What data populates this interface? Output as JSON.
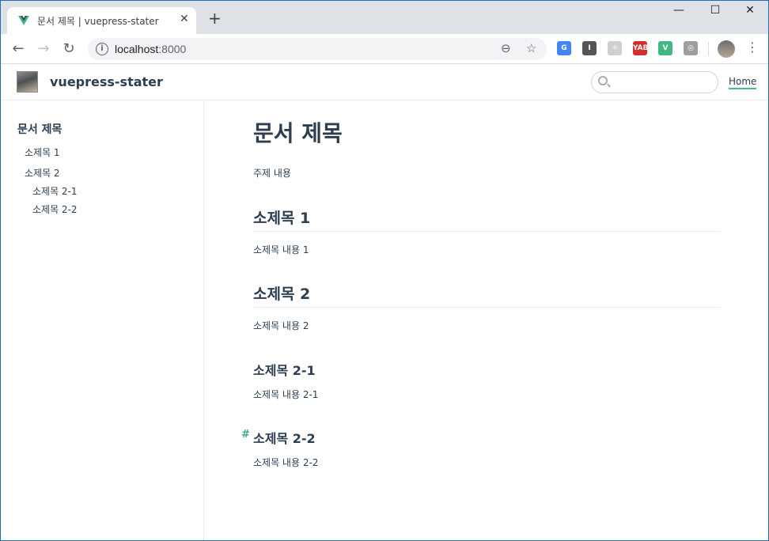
{
  "browser": {
    "tab_title": "문서 제목 | vuepress-stater",
    "tab_close": "✕",
    "new_tab": "+",
    "window_controls": {
      "minimize": "—",
      "maximize": "☐",
      "close": "✕"
    },
    "nav": {
      "back": "←",
      "forward": "→",
      "reload": "↻"
    },
    "address": {
      "host": "localhost",
      "port": ":8000"
    },
    "omnibox_icons": [
      "zoom-out-icon",
      "bookmark-star-icon"
    ],
    "extensions": [
      {
        "name": "google-translate-extension-icon",
        "label": "G",
        "color": "#4285f4"
      },
      {
        "name": "instapaper-extension-icon",
        "label": "I",
        "color": "#555555"
      },
      {
        "name": "react-devtools-extension-icon",
        "label": "⚛",
        "color": "#cfcfcf"
      },
      {
        "name": "yab-extension-icon",
        "label": "YAB",
        "color": "#d32f2f"
      },
      {
        "name": "vue-devtools-extension-icon",
        "label": "V",
        "color": "#41b883"
      },
      {
        "name": "globe-extension-icon",
        "label": "◎",
        "color": "#9e9e9e"
      }
    ],
    "menu": "⋮"
  },
  "site": {
    "name": "vuepress-stater",
    "search_placeholder": "",
    "nav_home": "Home",
    "accent": "#3eaf7c"
  },
  "sidebar": {
    "title": "문서 제목",
    "items": [
      {
        "label": "소제목 1"
      },
      {
        "label": "소제목 2"
      },
      {
        "label": "소제목 2-1"
      },
      {
        "label": "소제목 2-2"
      }
    ]
  },
  "content": {
    "h1": "문서 제목",
    "intro": "주제 내용",
    "sections": [
      {
        "heading": "소제목 1",
        "body": "소제목 내용 1"
      },
      {
        "heading": "소제목 2",
        "body": "소제목 내용 2"
      },
      {
        "heading": "소제목 2-1",
        "body": "소제목 내용 2-1"
      },
      {
        "heading": "소제목 2-2",
        "body": "소제목 내용 2-2"
      }
    ],
    "anchor_symbol": "#"
  }
}
